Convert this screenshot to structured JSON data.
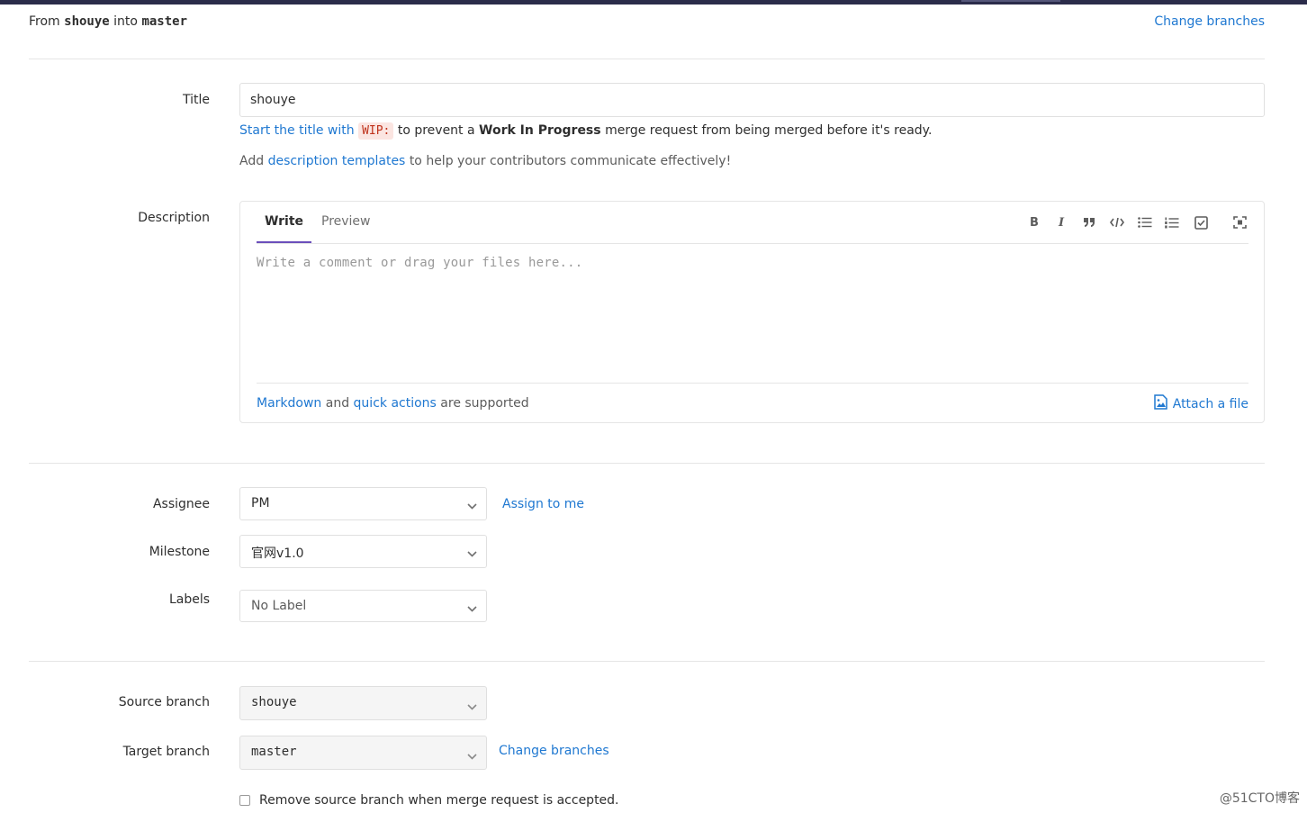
{
  "header": {
    "from_prefix": "From",
    "source": "shouye",
    "into": "into",
    "target": "master",
    "change_branches": "Change branches"
  },
  "title_field": {
    "label": "Title",
    "value": "shouye"
  },
  "wip_hint": {
    "link": "Start the title with",
    "code": "WIP:",
    "middle": "to prevent a",
    "bold": "Work In Progress",
    "end": "merge request from being merged before it's ready."
  },
  "template_hint": {
    "prefix": "Add",
    "link": "description templates",
    "suffix": "to help your contributors communicate effectively!"
  },
  "description": {
    "label": "Description",
    "tab_write": "Write",
    "tab_preview": "Preview",
    "placeholder": "Write a comment or drag your files here...",
    "footer_link1": "Markdown",
    "footer_and": "and",
    "footer_link2": "quick actions",
    "footer_suffix": "are supported",
    "attach": "Attach a file",
    "toolbar": [
      "bold-icon",
      "italic-icon",
      "quote-icon",
      "code-icon",
      "bullet-list-icon",
      "numbered-list-icon",
      "task-list-icon",
      "fullscreen-icon"
    ]
  },
  "assignee": {
    "label": "Assignee",
    "value": "PM",
    "assign_to_me": "Assign to me"
  },
  "milestone": {
    "label": "Milestone",
    "value": "官网v1.0"
  },
  "labels": {
    "label": "Labels",
    "value": "No Label"
  },
  "source_branch": {
    "label": "Source branch",
    "value": "shouye"
  },
  "target_branch": {
    "label": "Target branch",
    "value": "master",
    "change_branches": "Change branches"
  },
  "remove_source": {
    "label": "Remove source branch when merge request is accepted."
  },
  "watermark": "@51CTO博客",
  "colors": {
    "link": "#1f78d1",
    "active_tab": "#6b4fbb",
    "topbar": "#2b2c4a"
  }
}
